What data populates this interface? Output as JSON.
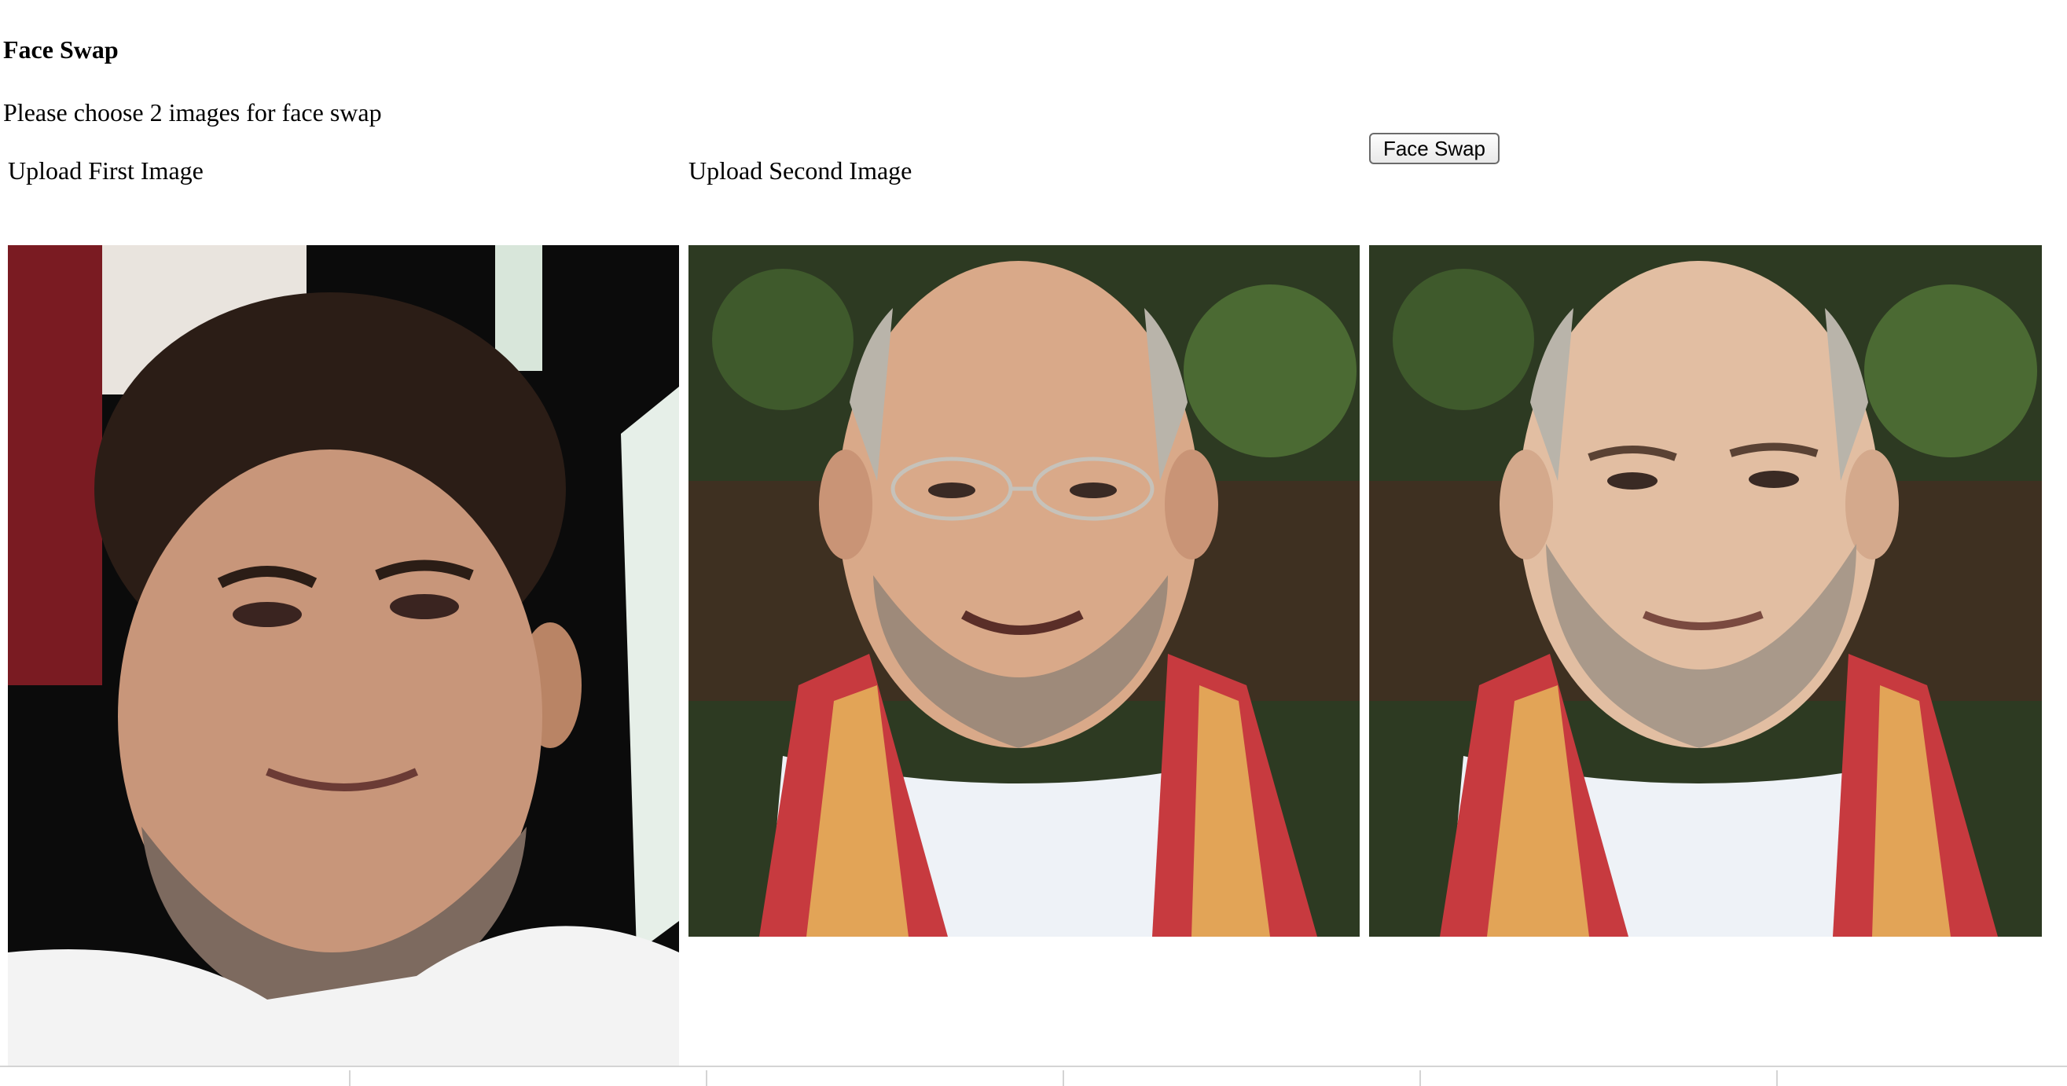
{
  "page": {
    "title": "Face Swap",
    "subtitle": "Please choose 2 images for face swap"
  },
  "uploads": {
    "first_label": "Upload First Image",
    "second_label": "Upload Second Image"
  },
  "actions": {
    "swap_label": "Face Swap"
  },
  "images": {
    "first": {
      "icon": "portrait-photo",
      "background_color": "#0b0b0b",
      "shirt_color": "#f3f3f3"
    },
    "second": {
      "icon": "portrait-photo",
      "background_color": "#2d3a22",
      "scarf_color": "#c73a3f"
    },
    "result": {
      "icon": "portrait-photo",
      "background_color": "#2d3a22",
      "scarf_color": "#c73a3f"
    }
  }
}
